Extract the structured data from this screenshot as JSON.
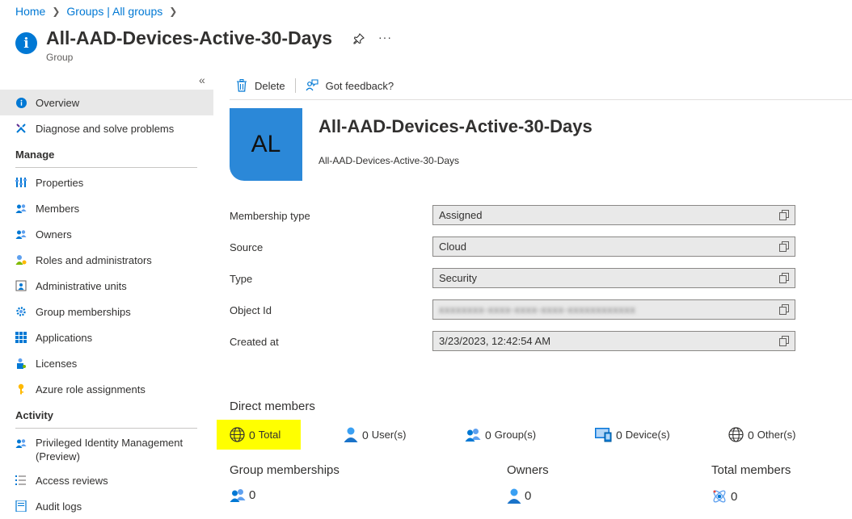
{
  "breadcrumb": [
    {
      "label": "Home"
    },
    {
      "label": "Groups | All groups"
    }
  ],
  "header": {
    "title": "All-AAD-Devices-Active-30-Days",
    "subtitle": "Group",
    "more": "···"
  },
  "sidebar": {
    "collapse": "«",
    "items": [
      {
        "label": "Overview",
        "icon": "info-icon"
      },
      {
        "label": "Diagnose and solve problems",
        "icon": "wrench-icon"
      }
    ],
    "manage_label": "Manage",
    "manage_items": [
      {
        "label": "Properties",
        "icon": "properties-icon"
      },
      {
        "label": "Members",
        "icon": "members-icon"
      },
      {
        "label": "Owners",
        "icon": "owners-icon"
      },
      {
        "label": "Roles and administrators",
        "icon": "roles-icon"
      },
      {
        "label": "Administrative units",
        "icon": "admin-units-icon"
      },
      {
        "label": "Group memberships",
        "icon": "gear-icon"
      },
      {
        "label": "Applications",
        "icon": "grid-icon"
      },
      {
        "label": "Licenses",
        "icon": "license-icon"
      },
      {
        "label": "Azure role assignments",
        "icon": "key-icon"
      }
    ],
    "activity_label": "Activity",
    "activity_items": [
      {
        "label": "Privileged Identity Management",
        "label2": "(Preview)",
        "icon": "pim-icon"
      },
      {
        "label": "Access reviews",
        "icon": "list-icon"
      },
      {
        "label": "Audit logs",
        "icon": "log-icon"
      }
    ]
  },
  "toolbar": {
    "delete_label": "Delete",
    "feedback_label": "Got feedback?"
  },
  "group": {
    "avatar_initials": "AL",
    "name": "All-AAD-Devices-Active-30-Days",
    "description": "All-AAD-Devices-Active-30-Days"
  },
  "properties": [
    {
      "label": "Membership type",
      "value": "Assigned"
    },
    {
      "label": "Source",
      "value": "Cloud"
    },
    {
      "label": "Type",
      "value": "Security"
    },
    {
      "label": "Object Id",
      "value": "xxxxxxxx-xxxx-xxxx-xxxx-xxxxxxxxxxxx"
    },
    {
      "label": "Created at",
      "value": "3/23/2023, 12:42:54 AM"
    }
  ],
  "direct_members": {
    "title": "Direct members",
    "total": {
      "count": "0",
      "label": "Total"
    },
    "users": {
      "count": "0",
      "label": "User(s)"
    },
    "groups": {
      "count": "0",
      "label": "Group(s)"
    },
    "devices": {
      "count": "0",
      "label": "Device(s)"
    },
    "others": {
      "count": "0",
      "label": "Other(s)"
    }
  },
  "summary": {
    "group_memberships": {
      "label": "Group memberships",
      "value": "0"
    },
    "owners": {
      "label": "Owners",
      "value": "0"
    },
    "total_members": {
      "label": "Total members",
      "value": "0"
    }
  },
  "colors": {
    "accent": "#0078d4",
    "avatar_bg": "#2b88d8",
    "highlight": "#ffff00"
  }
}
